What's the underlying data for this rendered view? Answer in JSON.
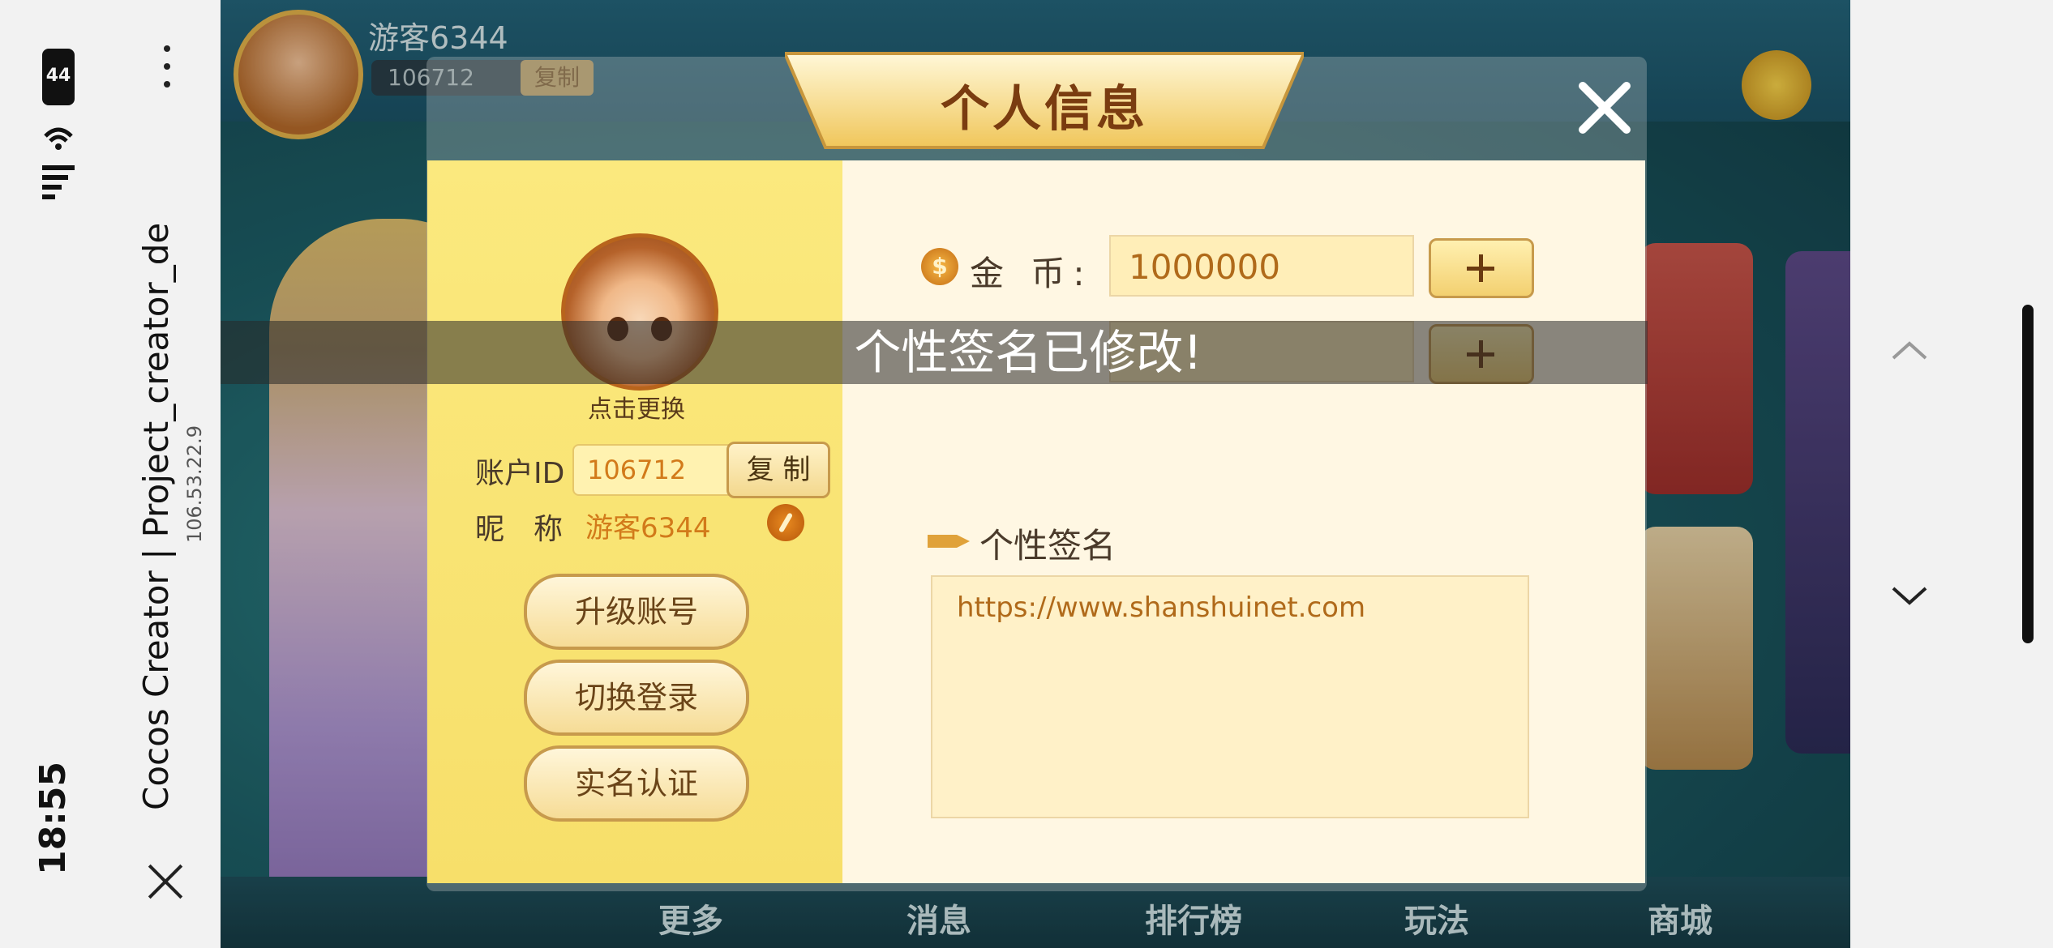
{
  "browser": {
    "time": "18:55",
    "battery": "44",
    "page_title": "Cocos Creator | Project_creator_de",
    "address": "106.53.22.9"
  },
  "background": {
    "player_name": "游客6344",
    "player_id": "106712",
    "copy_label": "复制",
    "bottom_nav": [
      "更多",
      "消息",
      "排行榜",
      "玩法",
      "商城"
    ]
  },
  "dialog": {
    "title": "个人信息",
    "avatar_hint": "点击更换",
    "account_id_label": "账户ID",
    "account_id": "106712",
    "copy_label": "复 制",
    "nickname_label": "昵　称",
    "nickname": "游客6344",
    "buttons": [
      "升级账号",
      "切换登录",
      "实名认证"
    ],
    "coin_label": "金 币:",
    "coin_value": "1000000",
    "signature_label": "个性签名",
    "signature_value": "https://www.shanshuinet.com"
  },
  "toast": "个性签名已修改!",
  "colors": {
    "accent_gold": "#f3d070",
    "panel_left": "#f7df6a",
    "panel_right": "#fff7e3",
    "value_text": "#d27a1a"
  }
}
